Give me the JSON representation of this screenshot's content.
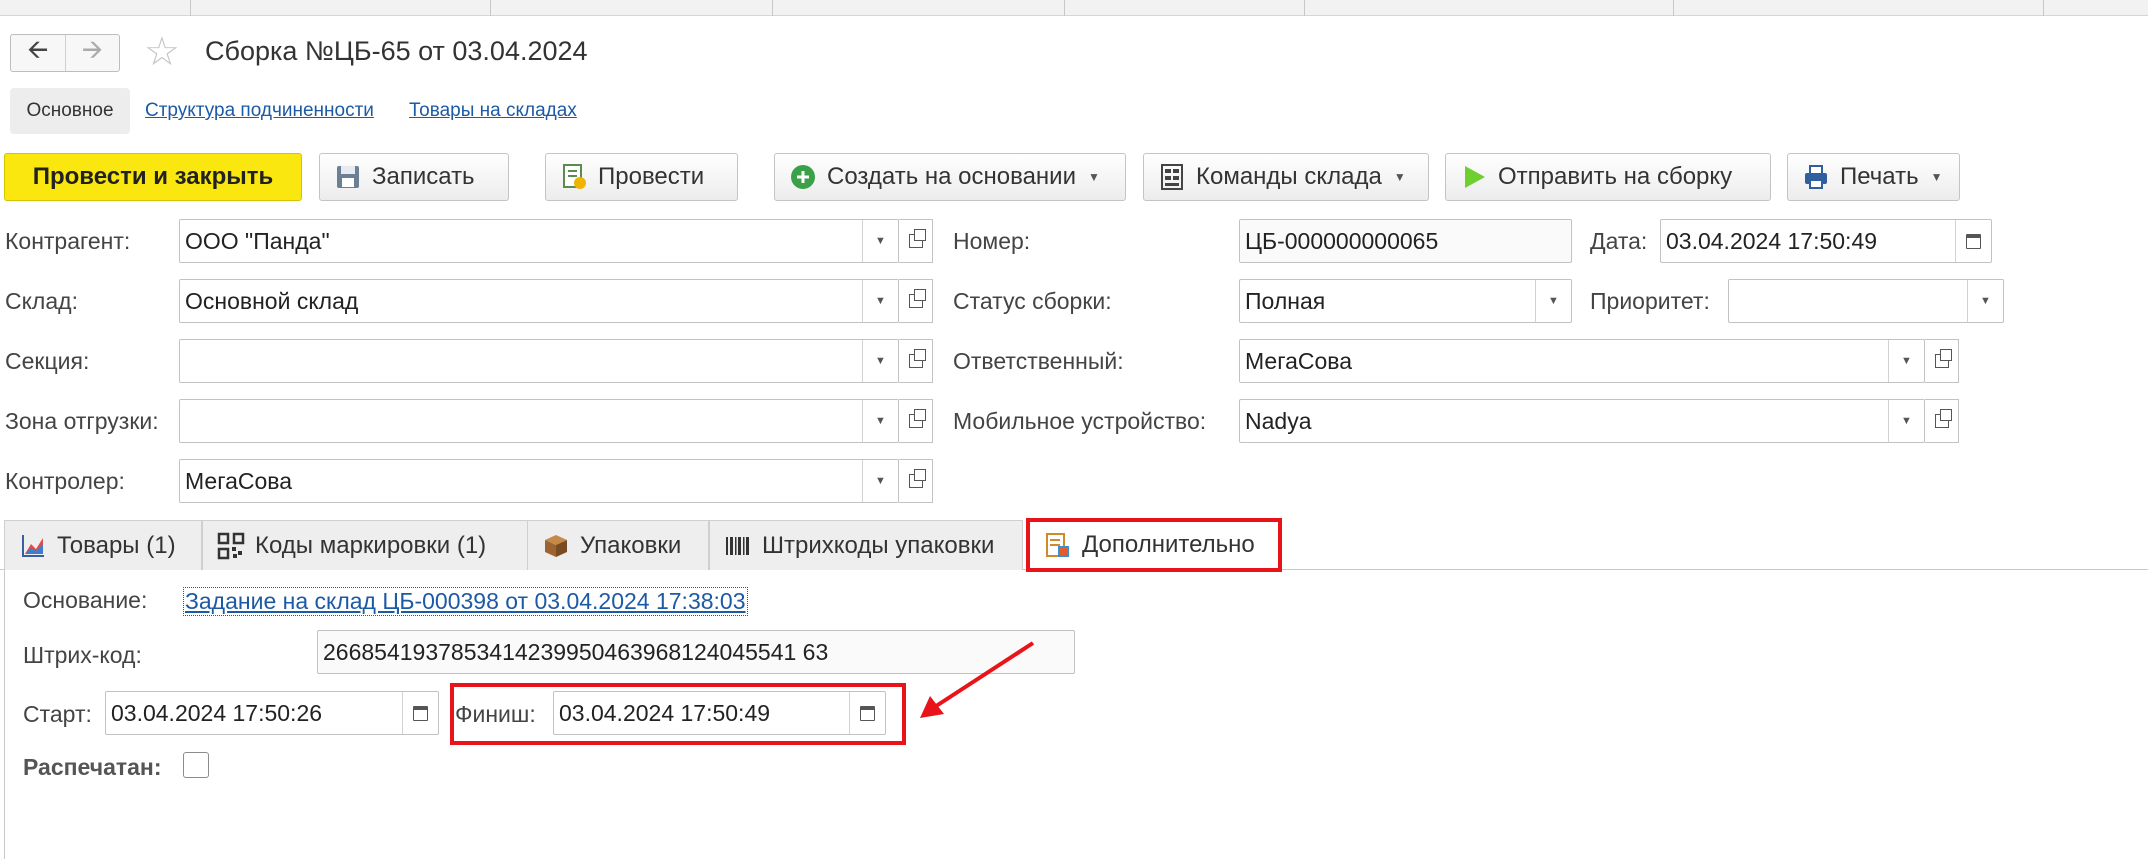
{
  "window": {
    "title": "Сборка №ЦБ-65 от 03.04.2024"
  },
  "form_tabs": {
    "main": "Основное",
    "subordination": "Структура подчиненности",
    "stock": "Товары на складах"
  },
  "toolbar": {
    "post_close": "Провести и закрыть",
    "save": "Записать",
    "post": "Провести",
    "create_based": "Создать на основании",
    "warehouse_cmds": "Команды склада",
    "send_assembly": "Отправить на сборку",
    "print": "Печать"
  },
  "fields": {
    "counterparty": {
      "label": "Контрагент:",
      "value": "ООО \"Панда\""
    },
    "warehouse": {
      "label": "Склад:",
      "value": "Основной склад"
    },
    "section": {
      "label": "Секция:",
      "value": ""
    },
    "shipment_zone": {
      "label": "Зона отгрузки:",
      "value": ""
    },
    "controller": {
      "label": "Контролер:",
      "value": "МегаСова"
    },
    "number": {
      "label": "Номер:",
      "value": "ЦБ-000000000065"
    },
    "date": {
      "label": "Дата:",
      "value": "03.04.2024 17:50:49"
    },
    "assembly_status": {
      "label": "Статус сборки:",
      "value": "Полная"
    },
    "priority": {
      "label": "Приоритет:",
      "value": ""
    },
    "responsible": {
      "label": "Ответственный:",
      "value": "МегаСова"
    },
    "mobile_device": {
      "label": "Мобильное устройство:",
      "value": "Nadya"
    }
  },
  "page_tabs": [
    {
      "label": "Товары (1)",
      "icon": "chart-icon"
    },
    {
      "label": "Коды маркировки  (1)",
      "icon": "qr-code-icon"
    },
    {
      "label": "Упаковки",
      "icon": "box-icon"
    },
    {
      "label": "Штрихкоды упаковки",
      "icon": "barcode-icon"
    },
    {
      "label": "Дополнительно",
      "icon": "document-icon",
      "active": true
    }
  ],
  "additional": {
    "basis_label": "Основание:",
    "basis_link": "Задание на склад ЦБ-000398 от 03.04.2024 17:38:03",
    "barcode_label": "Штрих-код:",
    "barcode_value": "2668541937853414239950463968124045541 63",
    "start_label": "Старт:",
    "start_value": "03.04.2024 17:50:26",
    "finish_label": "Финиш:",
    "finish_value": "03.04.2024 17:50:49",
    "printed_label": "Распечатан:",
    "printed_checked": false
  },
  "colors": {
    "primary_button": "#f9e70f",
    "link": "#1c5aa5",
    "annotation_red": "#e8141a"
  }
}
